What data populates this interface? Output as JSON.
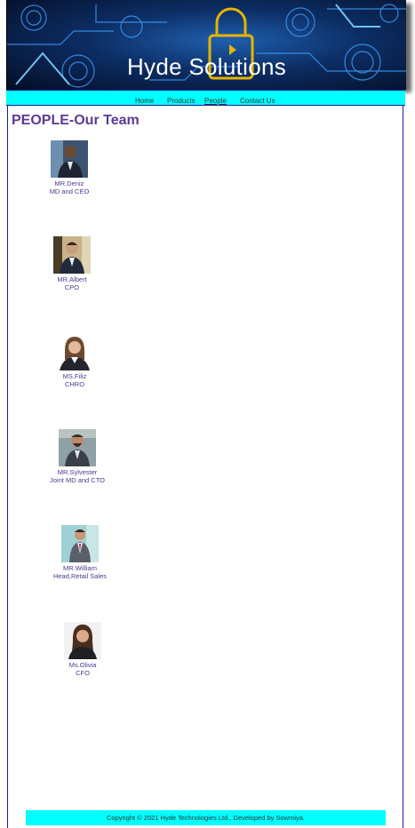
{
  "header": {
    "title": "Hyde Solutions"
  },
  "nav": {
    "items": [
      {
        "label": "Home"
      },
      {
        "label": "Products"
      },
      {
        "label": "People"
      },
      {
        "label": "Contact Us"
      }
    ],
    "active": "People"
  },
  "main": {
    "heading": "PEOPLE-Our Team",
    "people": [
      {
        "name": "MR.Deniz",
        "role": "MD and CEO"
      },
      {
        "name": "MR.Albert",
        "role": "CPO"
      },
      {
        "name": "MS.Filiz",
        "role": "CHRO"
      },
      {
        "name": "MR.Sylvester",
        "role": "Joint MD and CTO"
      },
      {
        "name": "MR.William",
        "role": "Head,Retail Sales"
      },
      {
        "name": "Ms.Olivia",
        "role": "CFO"
      }
    ]
  },
  "footer": {
    "text": "Copyright © 2021 Hyde Technologies Ltd., Developed by Sowmiya."
  },
  "colors": {
    "nav_background": "#00ffff",
    "heading": "#5c3b94",
    "person_text": "#4b3a8c",
    "border": "#1a1aa0"
  }
}
